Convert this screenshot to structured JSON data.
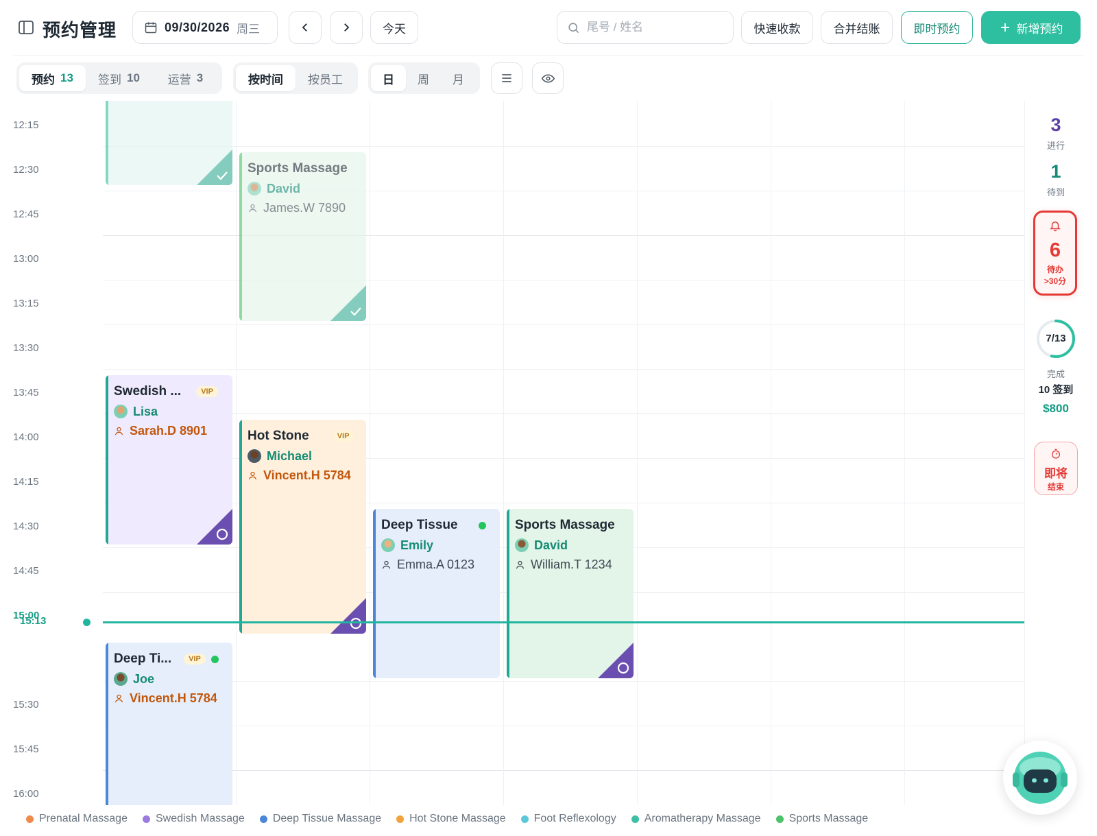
{
  "header": {
    "title": "预约管理",
    "date": "09/30/2026",
    "weekday": "周三",
    "today_label": "今天",
    "search_placeholder": "尾号 / 姓名",
    "quick_pay_label": "快速收款",
    "merge_bill_label": "合并结账",
    "instant_booking_label": "即时预约",
    "new_booking_label": "新增预约"
  },
  "toolbar": {
    "status_tabs": [
      {
        "label": "预约",
        "count": "13"
      },
      {
        "label": "签到",
        "count": "10"
      },
      {
        "label": "运营",
        "count": "3"
      }
    ],
    "view_modes": [
      "按时间",
      "按员工"
    ],
    "ranges": [
      "日",
      "周",
      "月"
    ]
  },
  "time_slots": [
    "12:15",
    "12:30",
    "12:45",
    "13:00",
    "13:15",
    "13:30",
    "13:45",
    "14:00",
    "14:15",
    "14:30",
    "14:45",
    "15:00",
    "15:30",
    "15:45",
    "16:00"
  ],
  "current_time": "15:13",
  "appointments": [
    {
      "id": "a1",
      "title": "",
      "therapist": "",
      "client": "",
      "vip": false,
      "online": false,
      "status": "done"
    },
    {
      "id": "a2",
      "title": "Sports Massage",
      "therapist": "David",
      "client": "James.W 7890",
      "vip": false,
      "online": false,
      "status": "done"
    },
    {
      "id": "a3",
      "title": "Swedish ...",
      "therapist": "Lisa",
      "client": "Sarah.D 8901",
      "vip": true,
      "vip_label": "VIP",
      "online": false,
      "status": "pending"
    },
    {
      "id": "a4",
      "title": "Hot Stone",
      "therapist": "Michael",
      "client": "Vincent.H 5784",
      "vip": true,
      "vip_label": "VIP",
      "online": false,
      "status": "pending"
    },
    {
      "id": "a5",
      "title": "Deep Tissue",
      "therapist": "Emily",
      "client": "Emma.A 0123",
      "vip": false,
      "online": true,
      "status": "in-progress"
    },
    {
      "id": "a6",
      "title": "Sports Massage",
      "therapist": "David",
      "client": "William.T 1234",
      "vip": false,
      "online": false,
      "status": "pending"
    },
    {
      "id": "a7",
      "title": "Deep Ti...",
      "therapist": "Joe",
      "client": "Vincent.H 5784",
      "vip": true,
      "vip_label": "VIP",
      "online": true,
      "status": "in-progress"
    }
  ],
  "side_panel": {
    "in_progress_count": "3",
    "in_progress_label": "进行",
    "waiting_count": "1",
    "waiting_label": "待到",
    "pending_count": "6",
    "pending_label": "待办",
    "pending_sub": ">30分",
    "progress_text": "7/13",
    "progress_fraction": 0.538,
    "done_label": "完成",
    "checkin_summary": "10 签到",
    "revenue": "$800",
    "ending_line1": "即将",
    "ending_line2": "结束"
  },
  "legend": [
    {
      "label": "Prenatal Massage",
      "color": "#f08a4b"
    },
    {
      "label": "Swedish Massage",
      "color": "#9b7be0"
    },
    {
      "label": "Deep Tissue Massage",
      "color": "#4c86d6"
    },
    {
      "label": "Hot Stone Massage",
      "color": "#f2a23a"
    },
    {
      "label": "Foot Reflexology",
      "color": "#5bc8d9"
    },
    {
      "label": "Aromatherapy Massage",
      "color": "#3cbfa3"
    },
    {
      "label": "Sports Massage",
      "color": "#4cc36a"
    }
  ],
  "colors": {
    "brand": "#2ebfa0",
    "alert": "#e53935",
    "swedish_bg": "#efeafd",
    "hot_stone_bg": "#fff0de",
    "deep_tissue_bg": "#e5eefa",
    "sports_bg": "#e3f5e9"
  }
}
